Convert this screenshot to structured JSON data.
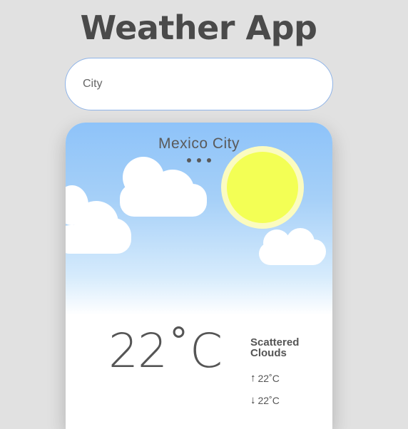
{
  "app": {
    "title": "Weather App"
  },
  "search": {
    "placeholder": "City",
    "value": ""
  },
  "weather": {
    "city": "Mexico City",
    "temperature": "22˚C",
    "description": "Scattered Clouds",
    "high": "22˚C",
    "low": "22˚C",
    "high_icon": "arrow-up-icon",
    "low_icon": "arrow-down-icon",
    "condition_icons": [
      "sun-icon",
      "cloud-icon"
    ]
  },
  "colors": {
    "background": "#e1e1e1",
    "title": "#4a4a4a",
    "sky_top": "#8ec3f9",
    "sun": "#f3ff55",
    "input_border": "#8fb4e8"
  }
}
